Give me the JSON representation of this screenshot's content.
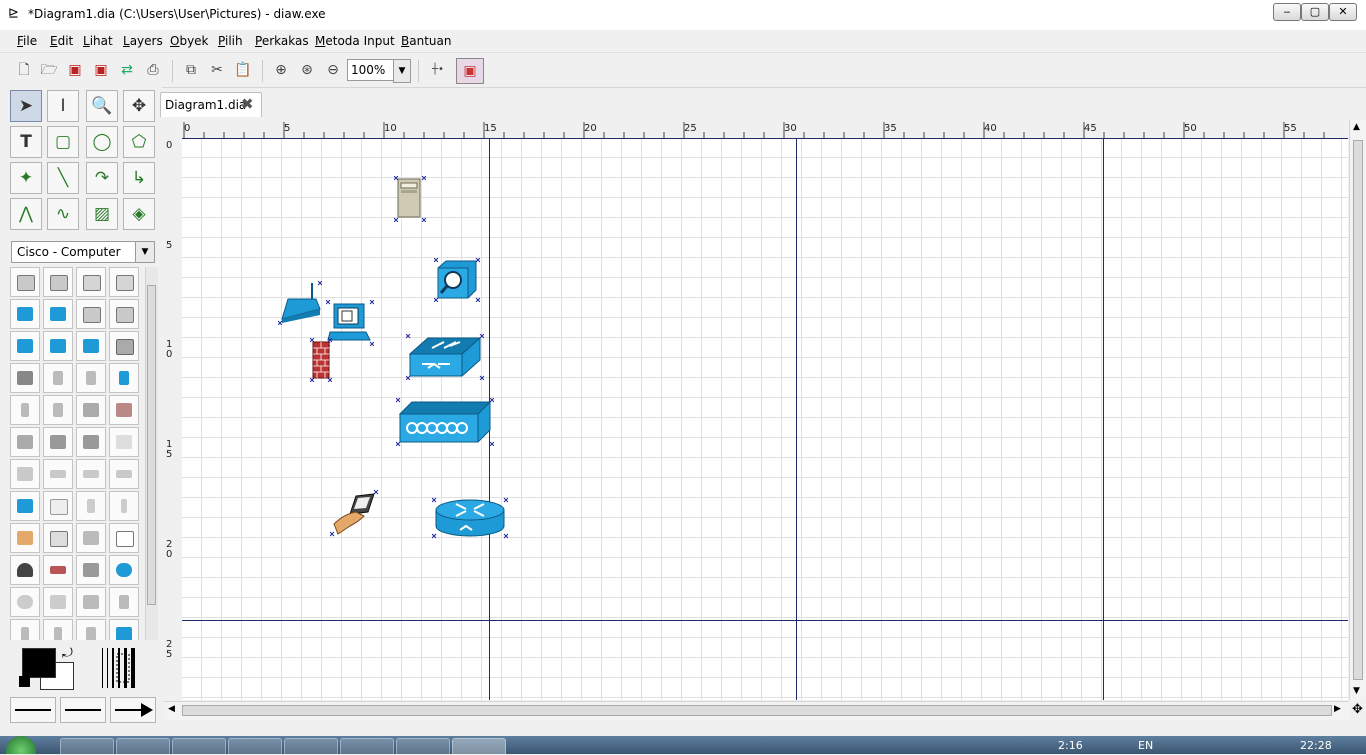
{
  "window": {
    "title": "*Diagram1.dia (C:\\Users\\User\\Pictures) - diaw.exe",
    "minimize": "‒",
    "maximize": "▢",
    "close": "✕"
  },
  "menu": [
    "File",
    "Edit",
    "Lihat",
    "Layers",
    "Obyek",
    "Pilih",
    "Perkakas",
    "Metoda Input",
    "Bantuan"
  ],
  "toolbar": {
    "zoom": "100%"
  },
  "sheet": {
    "selected": "Cisco - Computer"
  },
  "tab": {
    "label": "Diagram1.dia",
    "close": "✖"
  },
  "rulers": {
    "h_labels": [
      "0",
      "5",
      "10",
      "15",
      "20",
      "25",
      "30",
      "35",
      "40",
      "45",
      "50",
      "55"
    ],
    "v_labels": [
      "0",
      "5",
      "10",
      "15",
      "20",
      "25"
    ]
  },
  "taskbar": {
    "clock_left": "2:16",
    "lang": "EN",
    "clock_right": "22:28"
  },
  "colors": {
    "cisco_blue": "#1e9ad6",
    "page_break": "#1f2a6b",
    "handle": "#1f2a9b"
  }
}
